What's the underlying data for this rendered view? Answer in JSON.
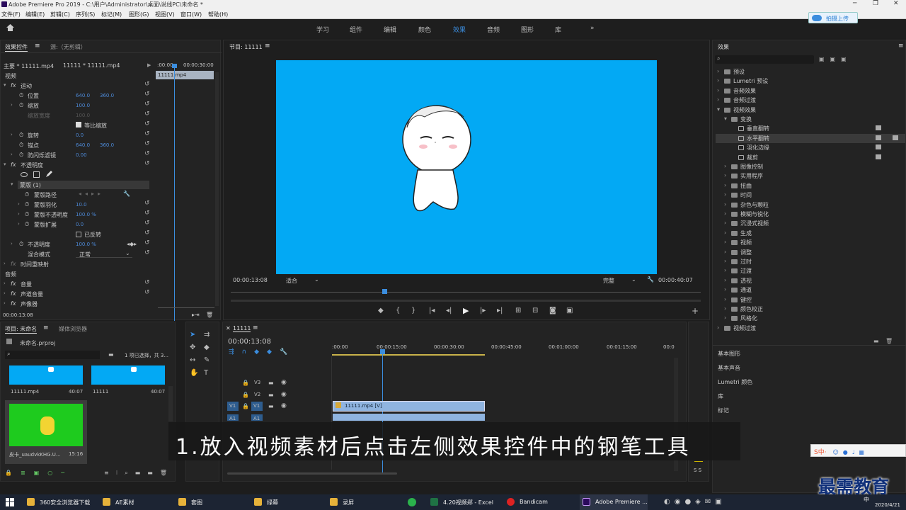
{
  "window": {
    "title": "Adobe Premiere Pro 2019 - C:\\用户\\Administrator\\桌面\\说线PC\\未命名 *",
    "minimize": "─",
    "maximize": "❐",
    "close": "✕"
  },
  "menu": [
    "文件(F)",
    "编辑(E)",
    "剪辑(C)",
    "序列(S)",
    "标记(M)",
    "图形(G)",
    "视图(V)",
    "窗口(W)",
    "帮助(H)"
  ],
  "workspaces": [
    "学习",
    "组件",
    "编辑",
    "颜色",
    "效果",
    "音频",
    "图形",
    "库"
  ],
  "workspace_active": "效果",
  "workspace_more": "»",
  "upload_label": "拍摄上传",
  "effect_controls": {
    "tab": "效果控件",
    "tab2": "源:（无剪辑）",
    "source_label": "主要 * 11111.mp4",
    "clip_label": "11111 * 11111.mp4",
    "tc_start": ":00:00",
    "tc_end": "00:00:30:00",
    "clip_bar": "11111.mp4",
    "video_header": "视频",
    "motion": "运动",
    "position_label": "位置",
    "position_x": "640.0",
    "position_y": "360.0",
    "scale_label": "缩放",
    "scale_val": "100.0",
    "scale_w_label": "缩放宽度",
    "scale_w_val": "100.0",
    "uniform_label": "等比缩放",
    "rotation_label": "旋转",
    "rotation_val": "0.0",
    "anchor_label": "锚点",
    "anchor_x": "640.0",
    "anchor_y": "360.0",
    "flicker_label": "防闪烁滤镜",
    "flicker_val": "0.00",
    "opacity_header": "不透明度",
    "mask_label": "蒙版 (1)",
    "mask_path": "蒙版路径",
    "mask_feather": "蒙版羽化",
    "mask_feather_val": "10.0",
    "mask_opacity": "蒙版不透明度",
    "mask_opacity_val": "100.0 %",
    "mask_expand": "蒙版扩展",
    "mask_expand_val": "0.0",
    "inverted_label": "已反转",
    "opacity_label": "不透明度",
    "opacity_val": "100.0 %",
    "blend_label": "混合模式",
    "blend_val": "正常",
    "time_remap": "时间重映射",
    "audio_header": "音频",
    "volume": "音量",
    "channel_volume": "声道音量",
    "panner": "声像器",
    "timecode": "00:00:13:08"
  },
  "program": {
    "title": "节目: 11111",
    "timecode": "00:00:13:08",
    "fit": "适合",
    "quality": "完整",
    "duration": "00:00:40:07"
  },
  "effects_panel": {
    "title": "效果",
    "search_placeholder": "",
    "items": [
      {
        "label": "预设",
        "indent": 0,
        "type": "folder",
        "open": false
      },
      {
        "label": "Lumetri 预设",
        "indent": 0,
        "type": "folder",
        "open": false
      },
      {
        "label": "音频效果",
        "indent": 0,
        "type": "folder",
        "open": false
      },
      {
        "label": "音频过渡",
        "indent": 0,
        "type": "folder",
        "open": false
      },
      {
        "label": "视频效果",
        "indent": 0,
        "type": "folder",
        "open": true
      },
      {
        "label": "变换",
        "indent": 1,
        "type": "folder",
        "open": true
      },
      {
        "label": "垂直翻转",
        "indent": 2,
        "type": "fx",
        "open": false
      },
      {
        "label": "水平翻转",
        "indent": 2,
        "type": "fx",
        "open": false,
        "selected": true
      },
      {
        "label": "羽化边缘",
        "indent": 2,
        "type": "fx",
        "open": false
      },
      {
        "label": "裁剪",
        "indent": 2,
        "type": "fx",
        "open": false
      },
      {
        "label": "图像控制",
        "indent": 1,
        "type": "folder",
        "open": false
      },
      {
        "label": "实用程序",
        "indent": 1,
        "type": "folder",
        "open": false
      },
      {
        "label": "扭曲",
        "indent": 1,
        "type": "folder",
        "open": false
      },
      {
        "label": "时间",
        "indent": 1,
        "type": "folder",
        "open": false
      },
      {
        "label": "杂色与颗粒",
        "indent": 1,
        "type": "folder",
        "open": false
      },
      {
        "label": "模糊与锐化",
        "indent": 1,
        "type": "folder",
        "open": false
      },
      {
        "label": "沉浸式视频",
        "indent": 1,
        "type": "folder",
        "open": false
      },
      {
        "label": "生成",
        "indent": 1,
        "type": "folder",
        "open": false
      },
      {
        "label": "视频",
        "indent": 1,
        "type": "folder",
        "open": false
      },
      {
        "label": "调整",
        "indent": 1,
        "type": "folder",
        "open": false
      },
      {
        "label": "过时",
        "indent": 1,
        "type": "folder",
        "open": false
      },
      {
        "label": "过渡",
        "indent": 1,
        "type": "folder",
        "open": false
      },
      {
        "label": "透视",
        "indent": 1,
        "type": "folder",
        "open": false
      },
      {
        "label": "通道",
        "indent": 1,
        "type": "folder",
        "open": false
      },
      {
        "label": "键控",
        "indent": 1,
        "type": "folder",
        "open": false
      },
      {
        "label": "颜色校正",
        "indent": 1,
        "type": "folder",
        "open": false
      },
      {
        "label": "风格化",
        "indent": 1,
        "type": "folder",
        "open": false
      },
      {
        "label": "视频过渡",
        "indent": 0,
        "type": "folder",
        "open": false
      }
    ],
    "extra_panels": [
      "基本图形",
      "基本声音",
      "Lumetri 颜色",
      "库",
      "标记"
    ]
  },
  "project": {
    "tab": "项目: 未命名",
    "tab2": "媒体浏览器",
    "file": "未命名.prproj",
    "selection": "1 项已选择，共 3...",
    "items": [
      {
        "name": "11111.mp4",
        "duration": "40:07"
      },
      {
        "name": "11111",
        "duration": "40:07"
      },
      {
        "name": "皮卡_uaudvkKHG.U...",
        "duration": "15:16"
      }
    ]
  },
  "timeline": {
    "tab": "11111",
    "timecode": "00:00:13:08",
    "ruler": [
      ":00:00",
      "00:00:15:00",
      "00:00:30:00",
      "00:00:45:00",
      "00:01:00:00",
      "00:01:15:00",
      "00:0"
    ],
    "tracks": [
      "V3",
      "V2",
      "V1",
      "A1"
    ],
    "clip": "11111.mp4 [V]",
    "meter": "S S"
  },
  "caption": "1.放入视频素材后点击左侧效果控件中的钢笔工具",
  "taskbar": {
    "items": [
      "360安全浏览器下载",
      "AE素材",
      "套图",
      "绿幕",
      "录屏",
      "4.20视频郑 - Excel",
      "Bandicam",
      "Adobe Premiere ..."
    ],
    "time": "中",
    "date": "2020/4/21"
  },
  "watermark": "最需教育",
  "ime": "S中·"
}
